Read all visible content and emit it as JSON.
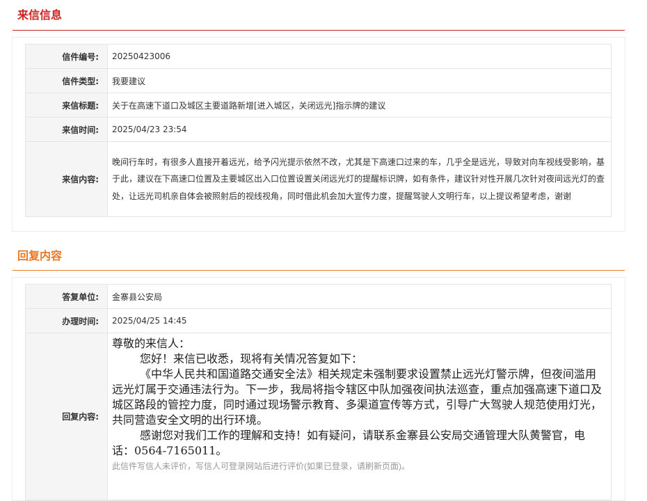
{
  "letter_section": {
    "title": "来信信息",
    "title_color": "#cc2222",
    "fields": {
      "number_label": "信件编号:",
      "number_value": "20250423006",
      "type_label": "信件类型:",
      "type_value": "我要建议",
      "subject_label": "来信标题:",
      "subject_value": "关于在高速下道口及城区主要道路新增[进入城区，关闭远光]指示牌的建议",
      "time_label": "来信时间:",
      "time_value": "2025/04/23 23:54",
      "content_label": "来信内容:",
      "content_value": "晚间行车时，有很多人直接开着远光，给予闪光提示依然不改，尤其是下高速口过来的车，几乎全是远光，导致对向车视线受影响，基于此，建议在下高速口位置及主要城区出入口位置设置关闭远光灯的提醒标识牌，如有条件，建议针对性开展几次针对夜间远光灯的查处，让远光司机亲自体会被照射后的视线视角，同时借此机会加大宣传力度，提醒驾驶人文明行车，以上提议希望考虑，谢谢"
    }
  },
  "reply_section": {
    "title": "回复内容",
    "title_color": "#ee7722",
    "fields": {
      "unit_label": "答复单位:",
      "unit_value": "金寨县公安局",
      "handle_time_label": "办理时间:",
      "handle_time_value": "2025/04/25 14:45",
      "reply_label": "回复内容:",
      "reply_salutation": "尊敬的来信人：",
      "reply_p1": "您好！来信已收悉，现将有关情况答复如下：",
      "reply_p2": "《中华人民共和国道路交通安全法》相关规定未强制要求设置禁止远光灯警示牌，但夜间滥用远光灯属于交通违法行为。下一步，我局将指令辖区中队加强夜间执法巡查，重点加强高速下道口及城区路段的管控力度，同时通过现场警示教育、多渠道宣传等方式，引导广大驾驶人规范使用灯光，共同营造安全文明的出行环境。",
      "reply_p3": "感谢您对我们工作的理解和支持！如有疑问，请联系金寨县公安局交通管理大队黄警官，电话：0564-7165011。",
      "evaluation_note": "此信件写信人未评价，写信人可登录网站后进行评价(如果已登录，请刷新页面)。"
    }
  }
}
